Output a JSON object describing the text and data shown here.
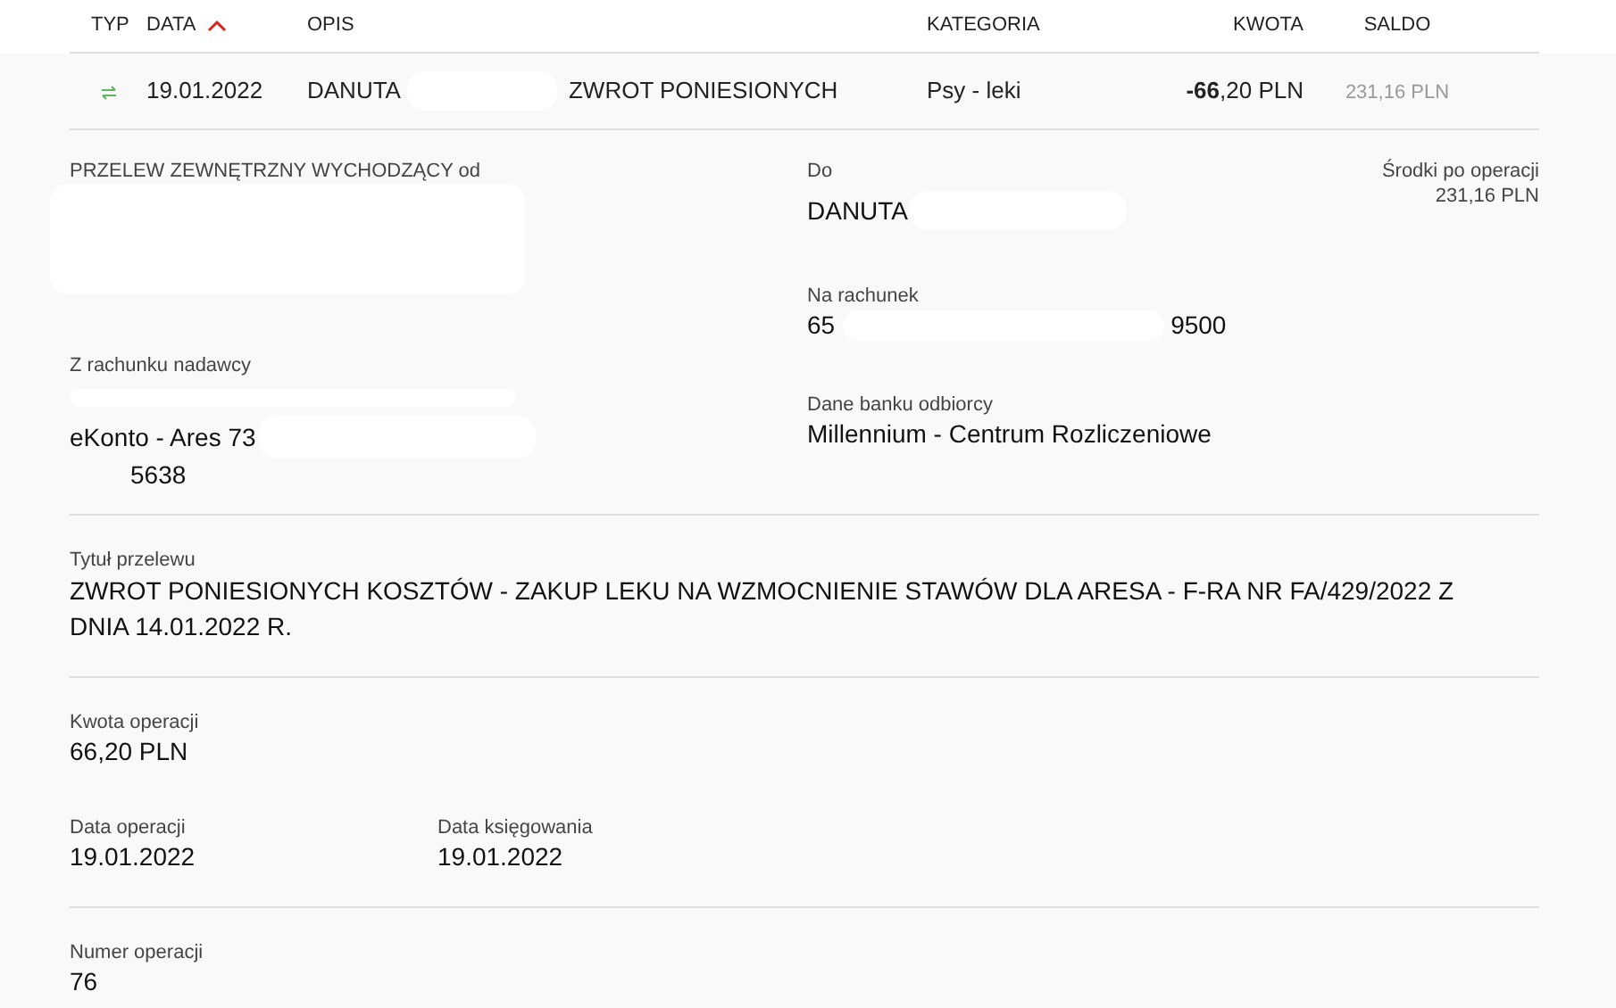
{
  "columns": [
    {
      "label": "TYP",
      "sorted": false
    },
    {
      "label": "DATA",
      "sorted": true
    },
    {
      "label": "OPIS",
      "sorted": false
    },
    {
      "label": "KATEGORIA",
      "sorted": false
    },
    {
      "label": "KWOTA",
      "sorted": false
    },
    {
      "label": "SALDO",
      "sorted": false
    }
  ],
  "row": {
    "date": "19.01.2022",
    "payee": "DANUTA",
    "title": "ZWROT PONIESIONYCH",
    "category": "Psy - leki",
    "amount": "**-66**,20 PLN",
    "balance": "231,16 PLN"
  },
  "details": {
    "type_label": "PRZELEW ZEWNĘTRZNY WYCHODZĄCY od",
    "to_label": "Do",
    "to_value": "DANUTA",
    "balance_label": "Środki po operacji",
    "balance_value": "231,16 PLN",
    "account_label": "Na rachunek",
    "account_start": "65",
    "account_end": "9500",
    "sender_label": "Z rachunku nadawcy",
    "sender_name": "eKonto - Ares 73",
    "sender_account_end": "5638",
    "bank_label": "Dane banku odbiorcy",
    "bank_value": "Millennium - Centrum Rozliczeniowe",
    "title_label": "Tytuł przelewu",
    "title_value": "ZWROT PONIESIONYCH KOSZTÓW - ZAKUP LEKU NA WZMOCNIENIE STAWÓW DLA ARESA - F-RA NR FA/429/2022 Z DNIA 14.01.2022 R.",
    "amount_label": "Kwota operacji",
    "amount_value": "66,20 PLN",
    "op_date_label": "Data operacji",
    "op_date_value": "19.01.2022",
    "book_date_label": "Data księgowania",
    "book_date_value": "19.01.2022",
    "number_label": "Numer operacji",
    "number_value": "76"
  }
}
